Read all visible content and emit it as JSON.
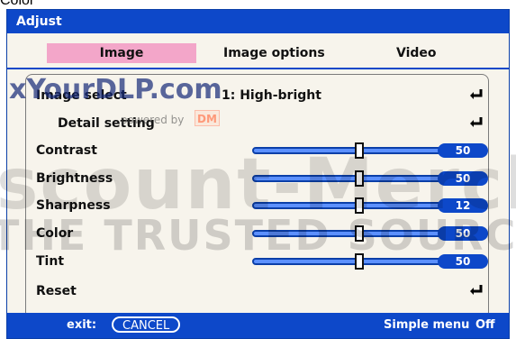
{
  "top_cut_label": "Color",
  "window": {
    "title": "Adjust"
  },
  "tabs": [
    {
      "label": "Image"
    },
    {
      "label": "Image options"
    },
    {
      "label": "Video"
    }
  ],
  "rows": [
    {
      "label": "Image select",
      "value": "1: High-bright"
    },
    {
      "label": "Detail setting"
    },
    {
      "label": "Contrast",
      "value": 50,
      "slider_fraction": 0.5
    },
    {
      "label": "Brightness",
      "value": 50,
      "slider_fraction": 0.5
    },
    {
      "label": "Sharpness",
      "value": 12,
      "slider_fraction": 0.5
    },
    {
      "label": "Color",
      "value": 50,
      "slider_fraction": 0.5
    },
    {
      "label": "Tint",
      "value": 50,
      "slider_fraction": 0.5
    },
    {
      "label": "Reset"
    }
  ],
  "footer": {
    "exit_label": "exit:",
    "cancel_label": "CANCEL",
    "simple_menu_label": "Simple menu",
    "simple_menu_state": "Off"
  },
  "watermark": {
    "brand": "xYourDLP.com",
    "powered_by": "powered by",
    "dm": "DM",
    "big": "scount-Merchan",
    "tagline": "THE TRUSTED SOURCE FOR PR"
  },
  "colors": {
    "accent_blue": "#0d48c9",
    "tab_active_pink": "#f3a6c9",
    "panel_bg": "#f7f4ec"
  }
}
